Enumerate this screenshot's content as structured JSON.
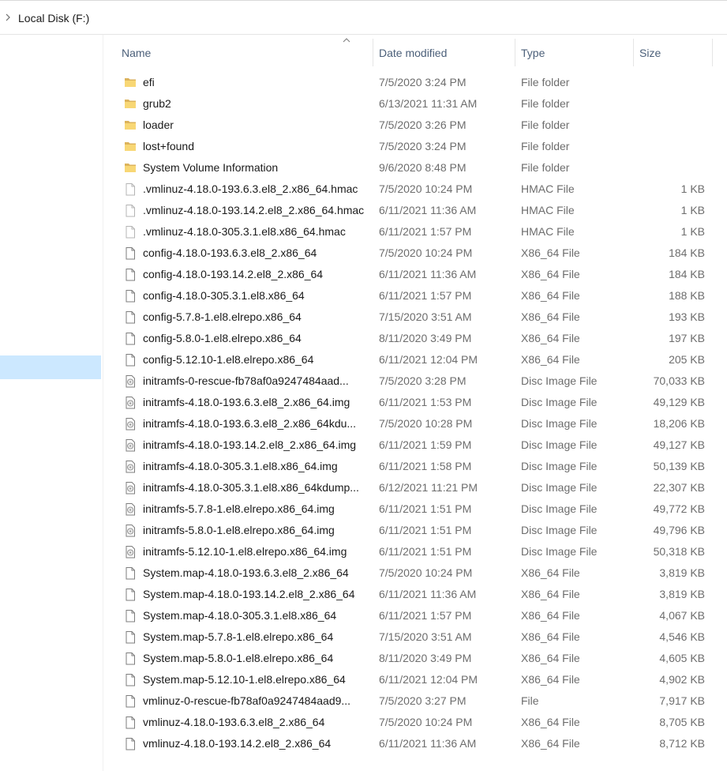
{
  "address": {
    "path": "Local Disk (F:)"
  },
  "columns": {
    "name": "Name",
    "date": "Date modified",
    "type": "Type",
    "size": "Size"
  },
  "files": [
    {
      "name": "efi",
      "date": "7/5/2020 3:24 PM",
      "type": "File folder",
      "size": "",
      "icon": "folder-icon"
    },
    {
      "name": "grub2",
      "date": "6/13/2021 11:31 AM",
      "type": "File folder",
      "size": "",
      "icon": "folder-icon"
    },
    {
      "name": "loader",
      "date": "7/5/2020 3:26 PM",
      "type": "File folder",
      "size": "",
      "icon": "folder-icon"
    },
    {
      "name": "lost+found",
      "date": "7/5/2020 3:24 PM",
      "type": "File folder",
      "size": "",
      "icon": "folder-icon"
    },
    {
      "name": "System Volume Information",
      "date": "9/6/2020 8:48 PM",
      "type": "File folder",
      "size": "",
      "icon": "folder-icon"
    },
    {
      "name": ".vmlinuz-4.18.0-193.6.3.el8_2.x86_64.hmac",
      "date": "7/5/2020 10:24 PM",
      "type": "HMAC File",
      "size": "1 KB",
      "icon": "file-icon-light"
    },
    {
      "name": ".vmlinuz-4.18.0-193.14.2.el8_2.x86_64.hmac",
      "date": "6/11/2021 11:36 AM",
      "type": "HMAC File",
      "size": "1 KB",
      "icon": "file-icon-light"
    },
    {
      "name": ".vmlinuz-4.18.0-305.3.1.el8.x86_64.hmac",
      "date": "6/11/2021 1:57 PM",
      "type": "HMAC File",
      "size": "1 KB",
      "icon": "file-icon-light"
    },
    {
      "name": "config-4.18.0-193.6.3.el8_2.x86_64",
      "date": "7/5/2020 10:24 PM",
      "type": "X86_64 File",
      "size": "184 KB",
      "icon": "file-icon"
    },
    {
      "name": "config-4.18.0-193.14.2.el8_2.x86_64",
      "date": "6/11/2021 11:36 AM",
      "type": "X86_64 File",
      "size": "184 KB",
      "icon": "file-icon"
    },
    {
      "name": "config-4.18.0-305.3.1.el8.x86_64",
      "date": "6/11/2021 1:57 PM",
      "type": "X86_64 File",
      "size": "188 KB",
      "icon": "file-icon"
    },
    {
      "name": "config-5.7.8-1.el8.elrepo.x86_64",
      "date": "7/15/2020 3:51 AM",
      "type": "X86_64 File",
      "size": "193 KB",
      "icon": "file-icon"
    },
    {
      "name": "config-5.8.0-1.el8.elrepo.x86_64",
      "date": "8/11/2020 3:49 PM",
      "type": "X86_64 File",
      "size": "197 KB",
      "icon": "file-icon"
    },
    {
      "name": "config-5.12.10-1.el8.elrepo.x86_64",
      "date": "6/11/2021 12:04 PM",
      "type": "X86_64 File",
      "size": "205 KB",
      "icon": "file-icon"
    },
    {
      "name": "initramfs-0-rescue-fb78af0a9247484aad...",
      "date": "7/5/2020 3:28 PM",
      "type": "Disc Image File",
      "size": "70,033 KB",
      "icon": "disc-image-icon"
    },
    {
      "name": "initramfs-4.18.0-193.6.3.el8_2.x86_64.img",
      "date": "6/11/2021 1:53 PM",
      "type": "Disc Image File",
      "size": "49,129 KB",
      "icon": "disc-image-icon"
    },
    {
      "name": "initramfs-4.18.0-193.6.3.el8_2.x86_64kdu...",
      "date": "7/5/2020 10:28 PM",
      "type": "Disc Image File",
      "size": "18,206 KB",
      "icon": "disc-image-icon"
    },
    {
      "name": "initramfs-4.18.0-193.14.2.el8_2.x86_64.img",
      "date": "6/11/2021 1:59 PM",
      "type": "Disc Image File",
      "size": "49,127 KB",
      "icon": "disc-image-icon"
    },
    {
      "name": "initramfs-4.18.0-305.3.1.el8.x86_64.img",
      "date": "6/11/2021 1:58 PM",
      "type": "Disc Image File",
      "size": "50,139 KB",
      "icon": "disc-image-icon"
    },
    {
      "name": "initramfs-4.18.0-305.3.1.el8.x86_64kdump...",
      "date": "6/12/2021 11:21 PM",
      "type": "Disc Image File",
      "size": "22,307 KB",
      "icon": "disc-image-icon"
    },
    {
      "name": "initramfs-5.7.8-1.el8.elrepo.x86_64.img",
      "date": "6/11/2021 1:51 PM",
      "type": "Disc Image File",
      "size": "49,772 KB",
      "icon": "disc-image-icon"
    },
    {
      "name": "initramfs-5.8.0-1.el8.elrepo.x86_64.img",
      "date": "6/11/2021 1:51 PM",
      "type": "Disc Image File",
      "size": "49,796 KB",
      "icon": "disc-image-icon"
    },
    {
      "name": "initramfs-5.12.10-1.el8.elrepo.x86_64.img",
      "date": "6/11/2021 1:51 PM",
      "type": "Disc Image File",
      "size": "50,318 KB",
      "icon": "disc-image-icon"
    },
    {
      "name": "System.map-4.18.0-193.6.3.el8_2.x86_64",
      "date": "7/5/2020 10:24 PM",
      "type": "X86_64 File",
      "size": "3,819 KB",
      "icon": "file-icon"
    },
    {
      "name": "System.map-4.18.0-193.14.2.el8_2.x86_64",
      "date": "6/11/2021 11:36 AM",
      "type": "X86_64 File",
      "size": "3,819 KB",
      "icon": "file-icon"
    },
    {
      "name": "System.map-4.18.0-305.3.1.el8.x86_64",
      "date": "6/11/2021 1:57 PM",
      "type": "X86_64 File",
      "size": "4,067 KB",
      "icon": "file-icon"
    },
    {
      "name": "System.map-5.7.8-1.el8.elrepo.x86_64",
      "date": "7/15/2020 3:51 AM",
      "type": "X86_64 File",
      "size": "4,546 KB",
      "icon": "file-icon"
    },
    {
      "name": "System.map-5.8.0-1.el8.elrepo.x86_64",
      "date": "8/11/2020 3:49 PM",
      "type": "X86_64 File",
      "size": "4,605 KB",
      "icon": "file-icon"
    },
    {
      "name": "System.map-5.12.10-1.el8.elrepo.x86_64",
      "date": "6/11/2021 12:04 PM",
      "type": "X86_64 File",
      "size": "4,902 KB",
      "icon": "file-icon"
    },
    {
      "name": "vmlinuz-0-rescue-fb78af0a9247484aad9...",
      "date": "7/5/2020 3:27 PM",
      "type": "File",
      "size": "7,917 KB",
      "icon": "file-icon"
    },
    {
      "name": "vmlinuz-4.18.0-193.6.3.el8_2.x86_64",
      "date": "7/5/2020 10:24 PM",
      "type": "X86_64 File",
      "size": "8,705 KB",
      "icon": "file-icon"
    },
    {
      "name": "vmlinuz-4.18.0-193.14.2.el8_2.x86_64",
      "date": "6/11/2021 11:36 AM",
      "type": "X86_64 File",
      "size": "8,712 KB",
      "icon": "file-icon"
    }
  ]
}
